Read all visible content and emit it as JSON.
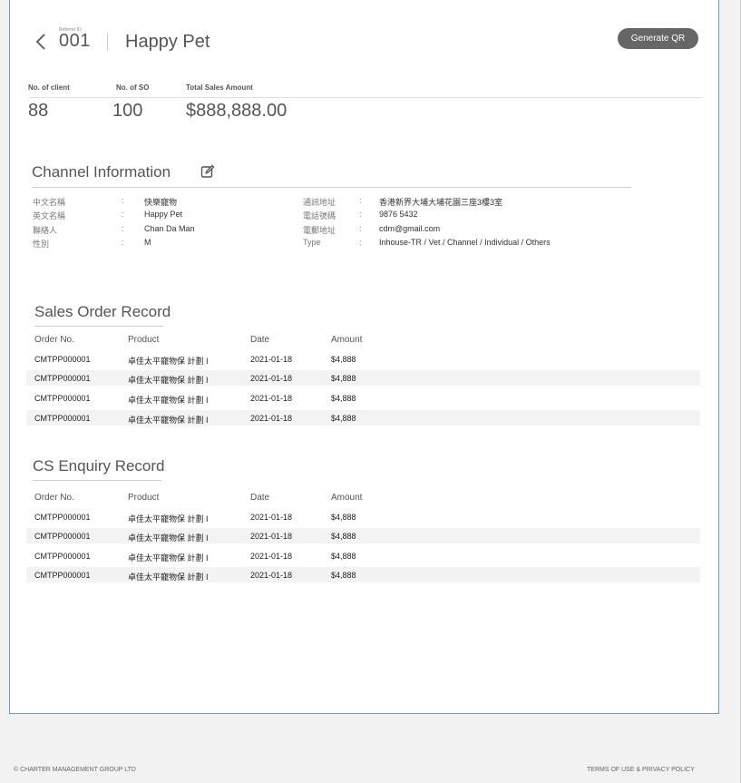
{
  "header": {
    "referrer_label": "Referrer ID",
    "referrer_id": "001",
    "name": "Happy Pet",
    "generate_qr_label": "Generate QR"
  },
  "stats": {
    "client_label": "No. of client",
    "client_value": "88",
    "so_label": "No. of SO",
    "so_value": "100",
    "amount_label": "Total Sales Amount",
    "amount_value": "$888,888.00"
  },
  "channel": {
    "title": "Channel Information",
    "left": [
      {
        "key": "中文名稱",
        "value": "快樂寵物"
      },
      {
        "key": "英文名稱",
        "value": "Happy Pet"
      },
      {
        "key": "聯絡人",
        "value": "Chan Da Man"
      },
      {
        "key": "性別",
        "value": "M"
      }
    ],
    "right": [
      {
        "key": "通訊地址",
        "value": "香港新界大埔大埔花園三座3樓3室"
      },
      {
        "key": "電話號碼",
        "value": "9876 5432"
      },
      {
        "key": "電郵地址",
        "value": "cdm@gmail.com"
      },
      {
        "key": "Type",
        "value": "Inhouse-TR / Vet / Channel / Individual / Others"
      }
    ],
    "colon": ":"
  },
  "sales": {
    "title": "Sales Order Record",
    "headers": [
      "Order No.",
      "Product",
      "Date",
      "Amount"
    ],
    "rows": [
      [
        "CMTPP000001",
        "卓佳太平寵物保 計劃 I",
        "2021-01-18",
        "$4,888"
      ],
      [
        "CMTPP000001",
        "卓佳太平寵物保 計劃 I",
        "2021-01-18",
        "$4,888"
      ],
      [
        "CMTPP000001",
        "卓佳太平寵物保 計劃 I",
        "2021-01-18",
        "$4,888"
      ],
      [
        "CMTPP000001",
        "卓佳太平寵物保 計劃 I",
        "2021-01-18",
        "$4,888"
      ]
    ]
  },
  "cs": {
    "title": "CS Enquiry Record",
    "headers": [
      "Order No.",
      "Product",
      "Date",
      "Amount"
    ],
    "rows": [
      [
        "CMTPP000001",
        "卓佳太平寵物保 計劃 I",
        "2021-01-18",
        "$4,888"
      ],
      [
        "CMTPP000001",
        "卓佳太平寵物保 計劃 I",
        "2021-01-18",
        "$4,888"
      ],
      [
        "CMTPP000001",
        "卓佳太平寵物保 計劃 I",
        "2021-01-18",
        "$4,888"
      ],
      [
        "CMTPP000001",
        "卓佳太平寵物保 計劃 I",
        "2021-01-18",
        "$4,888"
      ]
    ]
  },
  "footer": {
    "copyright": "© CHARTER MANAGEMENT GROUP LTD",
    "links": "TERMS OF USE & PRIVACY POLICY"
  }
}
